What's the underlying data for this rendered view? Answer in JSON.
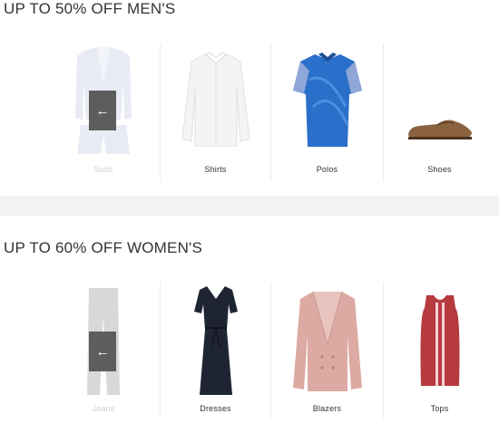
{
  "men": {
    "title": "UP TO 50% OFF MEN'S",
    "items": [
      {
        "label": "Suits",
        "icon": "suit-image"
      },
      {
        "label": "Shirts",
        "icon": "shirt-image"
      },
      {
        "label": "Polos",
        "icon": "polo-image"
      },
      {
        "label": "Shoes",
        "icon": "loafer-image"
      }
    ],
    "prev_arrow": "←"
  },
  "women": {
    "title": "UP TO 60% OFF WOMEN'S",
    "items": [
      {
        "label": "Jeans",
        "icon": "jeans-image"
      },
      {
        "label": "Dresses",
        "icon": "dress-image"
      },
      {
        "label": "Blazers",
        "icon": "blazer-image"
      },
      {
        "label": "Tops",
        "icon": "top-image"
      }
    ],
    "prev_arrow": "←"
  },
  "colors": {
    "divider": "#f2f2f2",
    "arrow_bg": "#5d5d5d",
    "polo_blue": "#2a6fc9",
    "dress_navy": "#1e2433",
    "blazer_pink": "#dcaaa3",
    "top_red": "#b63a3e"
  }
}
